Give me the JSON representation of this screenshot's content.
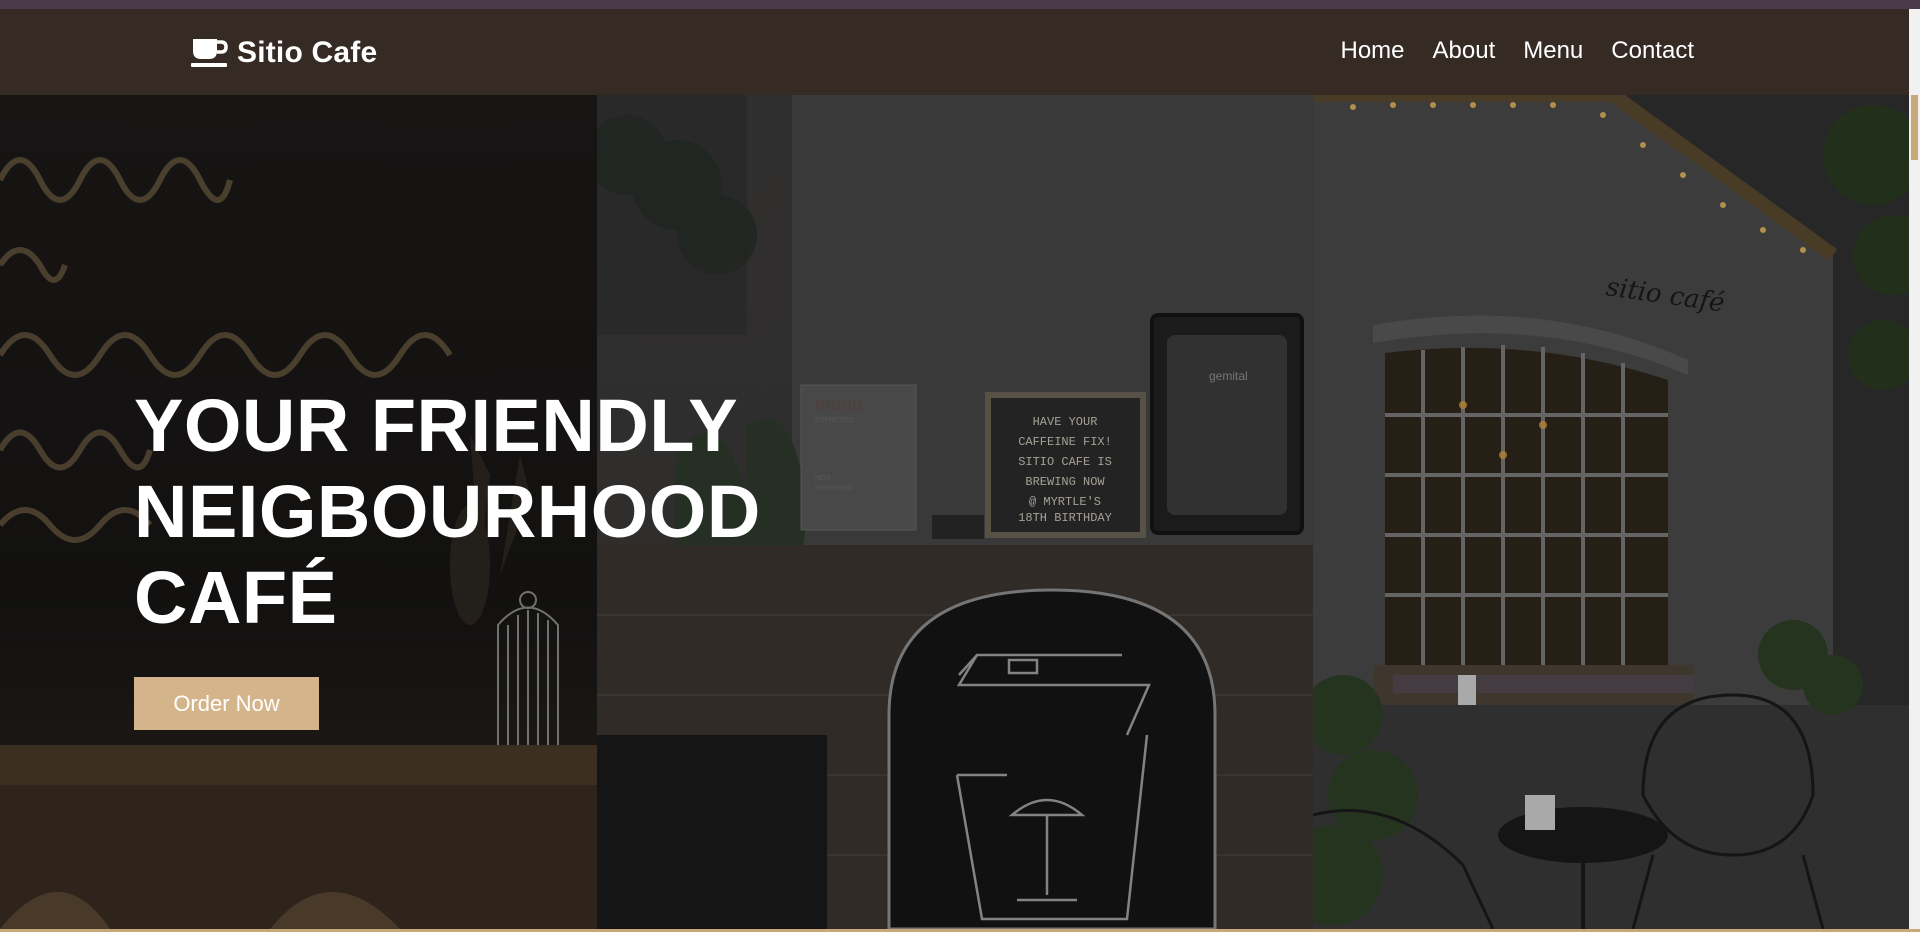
{
  "brand": {
    "name": "Sitio Cafe",
    "icon": "coffee-cup-icon"
  },
  "nav": {
    "items": [
      {
        "label": "Home"
      },
      {
        "label": "About"
      },
      {
        "label": "Menu"
      },
      {
        "label": "Contact"
      }
    ]
  },
  "hero": {
    "title_lines": [
      "YOUR FRIENDLY",
      "NEIGBOURHOOD",
      "CAFÉ"
    ],
    "cta_label": "Order Now"
  },
  "photos": {
    "chalkboard_text": [
      "HAVE YOUR",
      "CAFFEINE FIX!",
      "SITIO CAFE IS",
      "BREWING NOW",
      "@ MYRTLE'S",
      "18TH BIRTHDAY"
    ],
    "menu_card_title": "menu",
    "menu_card_lines": [
      "ESPRESSO",
      "NON",
      "ESPRESSO"
    ],
    "machine_brand": "gemital",
    "storefront_sign": "sitio café"
  },
  "colors": {
    "nav_background": "#352a24",
    "accent": "#d4b48a",
    "text": "#ffffff"
  }
}
